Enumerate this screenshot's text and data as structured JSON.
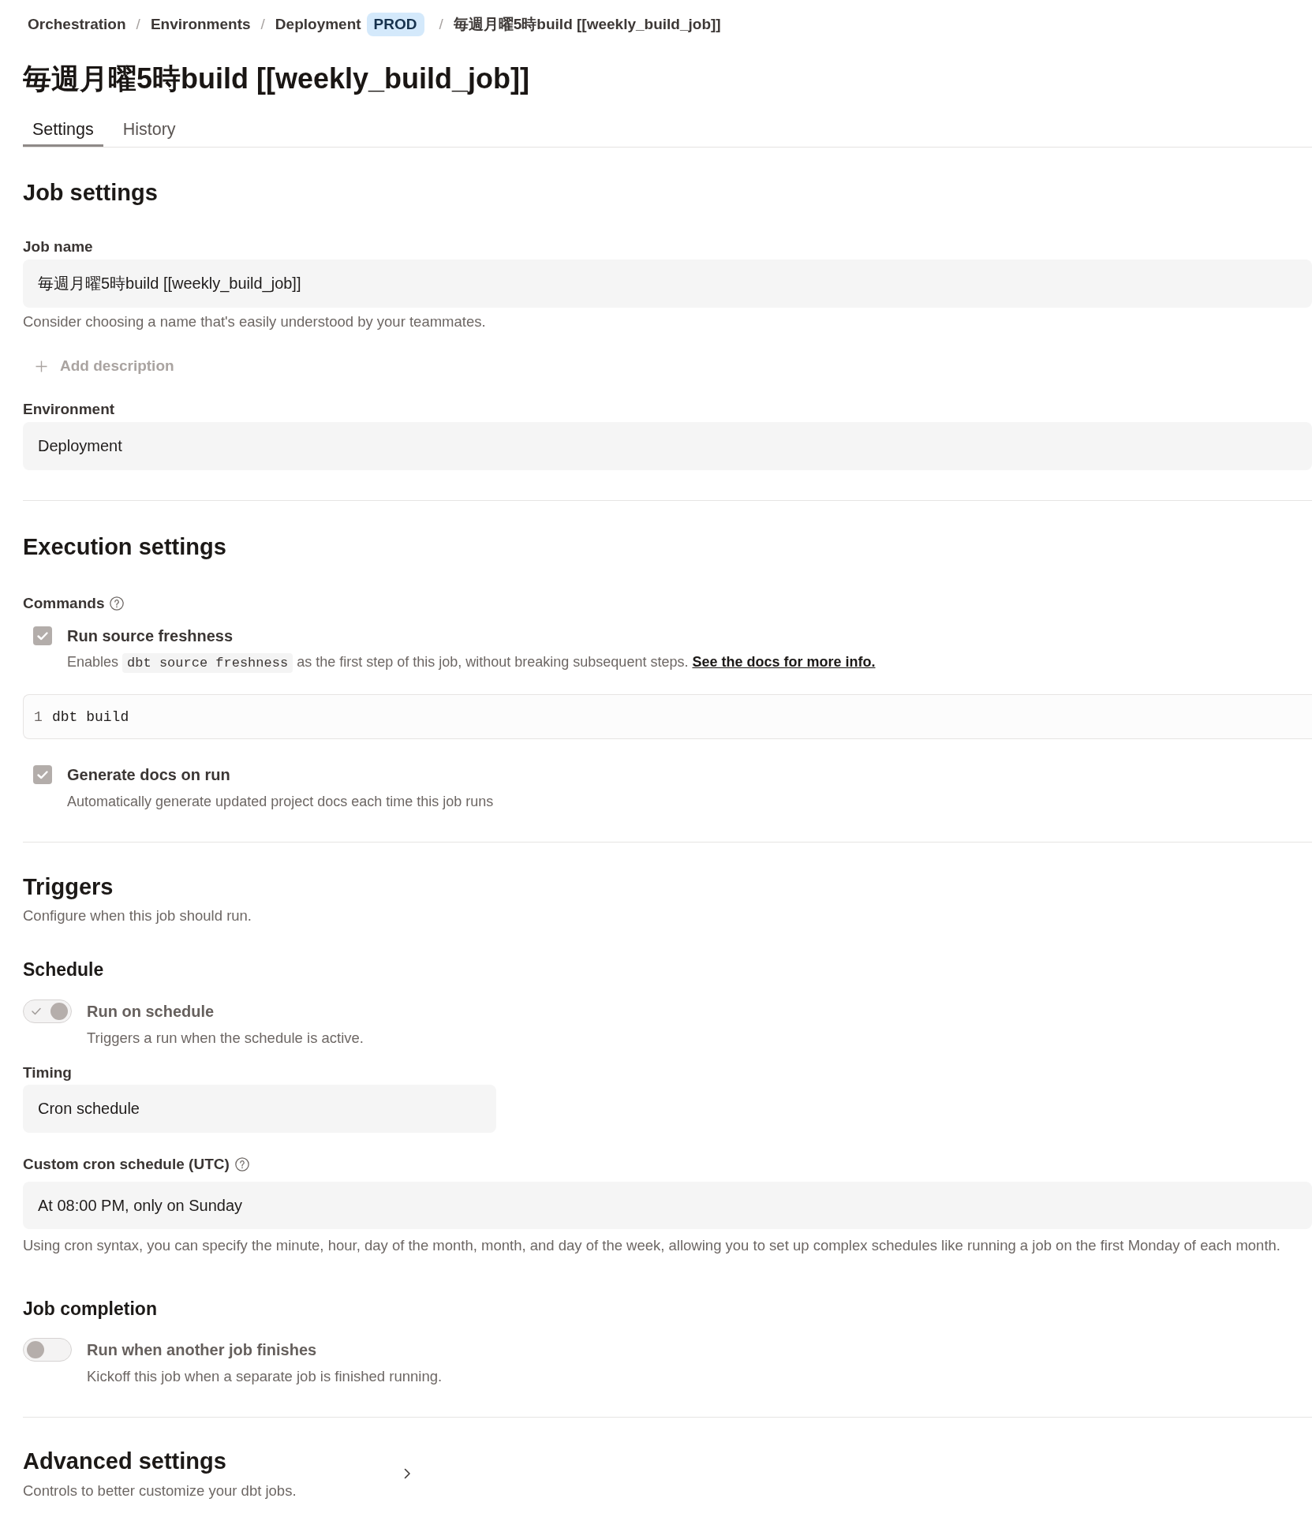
{
  "breadcrumbs": {
    "separator": "/",
    "items": [
      {
        "label": "Orchestration"
      },
      {
        "label": "Environments"
      },
      {
        "label": "Deployment",
        "badge": "PROD"
      },
      {
        "label": "毎週月曜5時build [[weekly_build_job]]"
      }
    ]
  },
  "title": "毎週月曜5時build [[weekly_build_job]]",
  "tabs": [
    {
      "label": "Settings",
      "selected": true
    },
    {
      "label": "History",
      "selected": false
    }
  ],
  "job_settings": {
    "heading": "Job settings",
    "job_name": {
      "label": "Job name",
      "value": "毎週月曜5時build [[weekly_build_job]]",
      "help": "Consider choosing a name that's easily understood by your teammates."
    },
    "add_description": "Add description",
    "environment": {
      "label": "Environment",
      "value": "Deployment"
    }
  },
  "execution_settings": {
    "heading": "Execution settings",
    "commands_label": "Commands",
    "source_freshness": {
      "label": "Run source freshness",
      "checked": true,
      "description": {
        "before": "Enables",
        "code": "dbt source freshness",
        "after": "as the first step of this job, without breaking subsequent steps.",
        "link": "See the docs for more info."
      }
    },
    "editor_lines": [
      {
        "number": "1",
        "code": "dbt build"
      }
    ],
    "generate_docs": {
      "label": "Generate docs on run",
      "checked": true,
      "description": "Automatically generate updated project docs each time this job runs"
    }
  },
  "triggers": {
    "heading": "Triggers",
    "subtitle": "Configure when this job should run.",
    "schedule": {
      "heading": "Schedule",
      "toggle": {
        "label": "Run on schedule",
        "on": true,
        "description": "Triggers a run when the schedule is active."
      },
      "timing": {
        "label": "Timing",
        "value": "Cron schedule"
      },
      "cron": {
        "label": "Custom cron schedule (UTC)",
        "value": "At 08:00 PM, only on Sunday",
        "help": "Using cron syntax, you can specify the minute, hour, day of the month, month, and day of the week, allowing you to set up complex schedules like running a job on the first Monday of each month."
      }
    },
    "job_completion": {
      "heading": "Job completion",
      "toggle": {
        "label": "Run when another job finishes",
        "on": false,
        "description": "Kickoff this job when a separate job is finished running."
      }
    }
  },
  "advanced_settings": {
    "heading": "Advanced settings",
    "subtitle": "Controls to better customize your dbt jobs.",
    "expanded": false
  }
}
